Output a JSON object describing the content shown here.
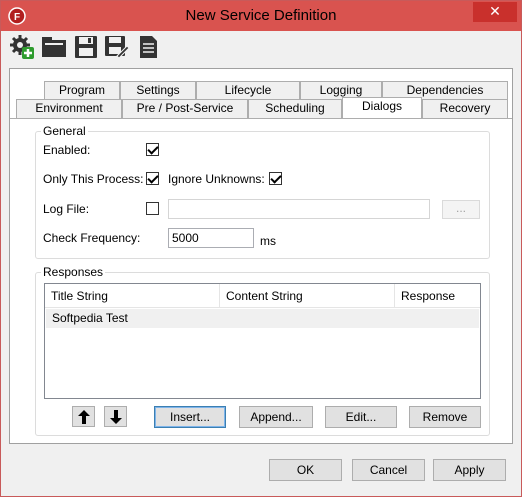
{
  "window": {
    "title": "New Service Definition",
    "close_glyph": "✕"
  },
  "toolbar": {
    "icons": [
      "add-gear-icon",
      "open-folder-icon",
      "save-icon",
      "save-as-icon",
      "document-icon"
    ]
  },
  "tabs": {
    "row1": [
      "Program",
      "Settings",
      "Lifecycle",
      "Logging",
      "Dependencies"
    ],
    "row2": [
      "Environment",
      "Pre / Post-Service",
      "Scheduling",
      "Dialogs",
      "Recovery"
    ],
    "active": "Dialogs"
  },
  "general": {
    "group_label": "General",
    "enabled_label": "Enabled:",
    "enabled_checked": true,
    "only_this_process_label": "Only This Process:",
    "only_this_process_checked": true,
    "ignore_unknowns_label": "Ignore Unknowns:",
    "ignore_unknowns_checked": true,
    "log_file_label": "Log File:",
    "log_file_checked": false,
    "log_file_value": "",
    "browse_label": "...",
    "check_frequency_label": "Check Frequency:",
    "check_frequency_value": "5000",
    "check_frequency_unit": "ms"
  },
  "responses": {
    "group_label": "Responses",
    "columns": [
      "Title String",
      "Content String",
      "Response"
    ],
    "rows": [
      {
        "title": "Softpedia Test",
        "content": "",
        "response": ""
      }
    ],
    "up_glyph": "🡅",
    "down_glyph": "🡇",
    "insert_label": "Insert...",
    "append_label": "Append...",
    "edit_label": "Edit...",
    "remove_label": "Remove"
  },
  "footer": {
    "ok_label": "OK",
    "cancel_label": "Cancel",
    "apply_label": "Apply"
  },
  "colors": {
    "titlebar": "#d9534f",
    "close": "#c9302c",
    "accent": "#3c7fb1"
  }
}
